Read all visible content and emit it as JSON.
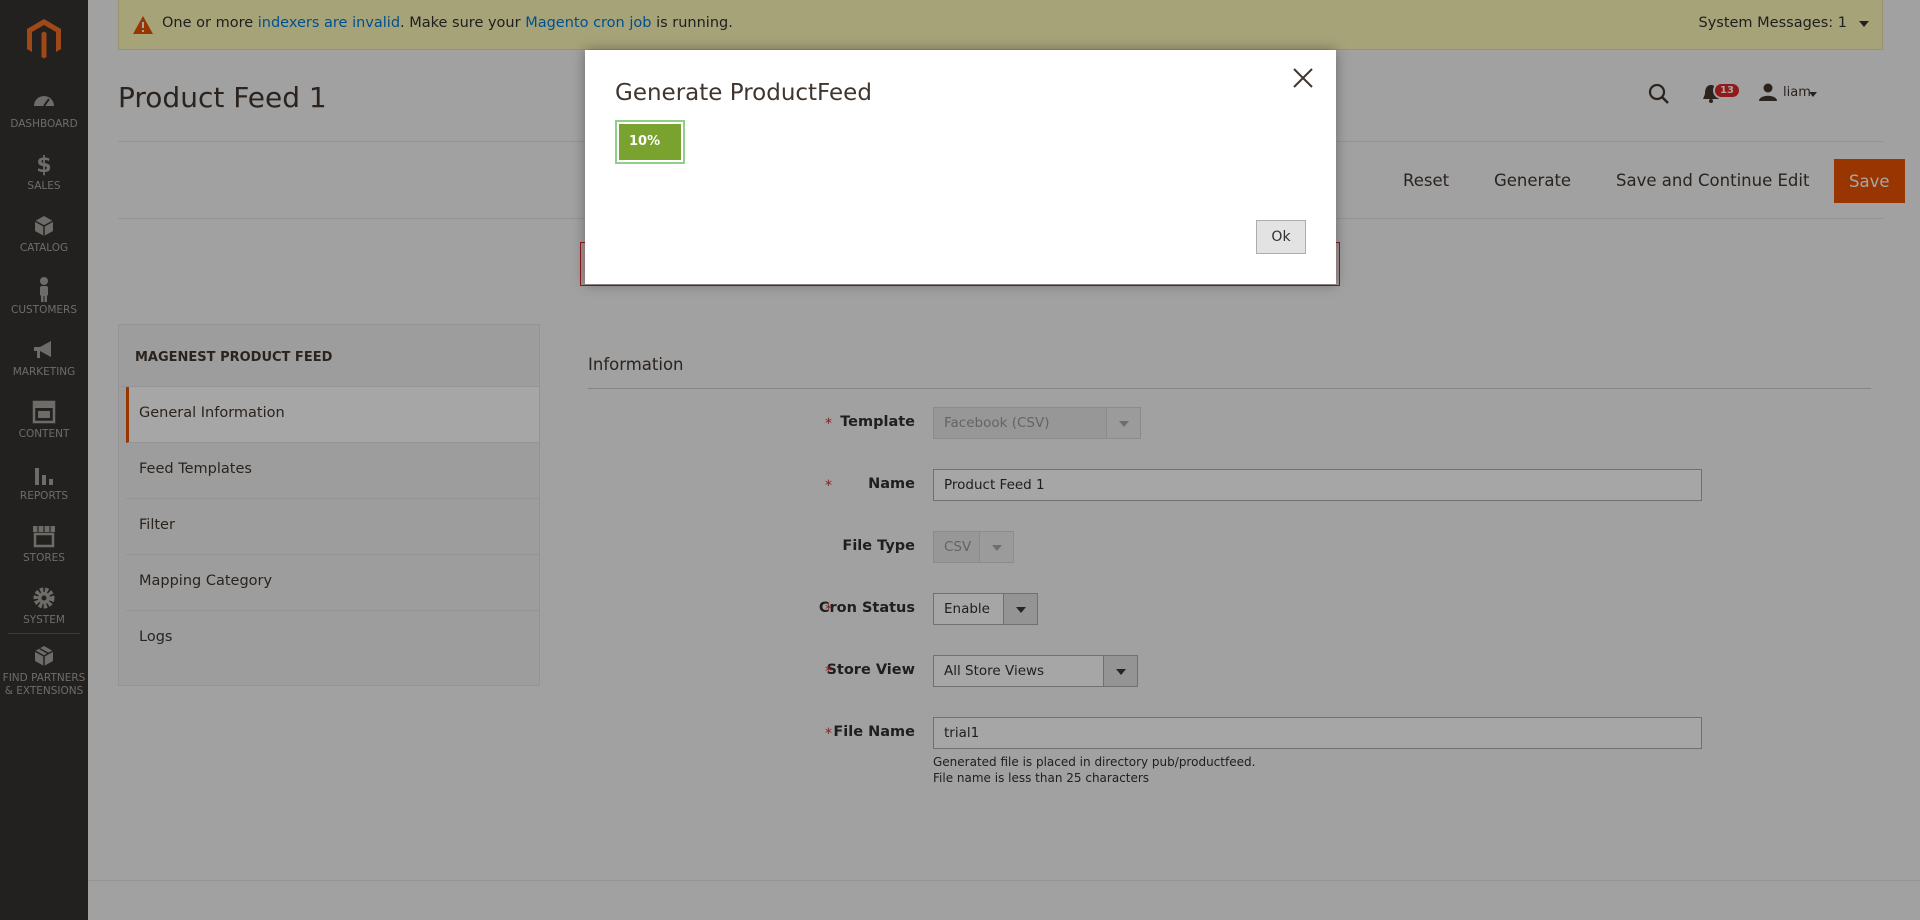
{
  "sidebar": {
    "items": [
      {
        "label": "DASHBOARD",
        "icon": "dashboard-icon"
      },
      {
        "label": "SALES",
        "icon": "dollar-icon"
      },
      {
        "label": "CATALOG",
        "icon": "box-icon"
      },
      {
        "label": "CUSTOMERS",
        "icon": "person-icon"
      },
      {
        "label": "MARKETING",
        "icon": "megaphone-icon"
      },
      {
        "label": "CONTENT",
        "icon": "layout-icon"
      },
      {
        "label": "REPORTS",
        "icon": "bar-chart-icon"
      },
      {
        "label": "STORES",
        "icon": "storefront-icon"
      },
      {
        "label": "SYSTEM",
        "icon": "gear-icon"
      }
    ],
    "partners_line1": "FIND PARTNERS",
    "partners_line2": "& EXTENSIONS"
  },
  "system_message": {
    "prefix": "One or more ",
    "link1": "indexers are invalid",
    "middle": ". Make sure your ",
    "link2": "Magento cron job",
    "suffix": " is running.",
    "count_label": "System Messages: 1"
  },
  "header": {
    "page_title": "Product Feed 1",
    "notification_count": "13",
    "user_name": "liam"
  },
  "toolbar": {
    "reset": "Reset",
    "generate": "Generate",
    "save_continue": "Save and Continue Edit",
    "save": "Save"
  },
  "tabs": {
    "heading": "MAGENEST PRODUCT FEED",
    "items": [
      "General Information",
      "Feed Templates",
      "Filter",
      "Mapping Category",
      "Logs"
    ]
  },
  "form": {
    "section_title": "Information",
    "template_label": "Template",
    "template_value": "Facebook (CSV)",
    "name_label": "Name",
    "name_value": "Product Feed 1",
    "file_type_label": "File Type",
    "file_type_value": "CSV",
    "cron_label": "Cron Status",
    "cron_value": "Enable",
    "store_label": "Store View",
    "store_value": "All Store Views",
    "file_name_label": "File Name",
    "file_name_value": "trial1",
    "note1": "Generated file is placed in directory pub/productfeed.",
    "note2": "File name is less than 25 characters",
    "required_mark": "*"
  },
  "modal": {
    "title": "Generate ProductFeed",
    "progress_label": "10%",
    "progress_fraction": 0.1,
    "ok": "Ok"
  },
  "colors": {
    "accent": "#eb5202",
    "sidebar": "#373330",
    "progress": "#79a22e"
  }
}
